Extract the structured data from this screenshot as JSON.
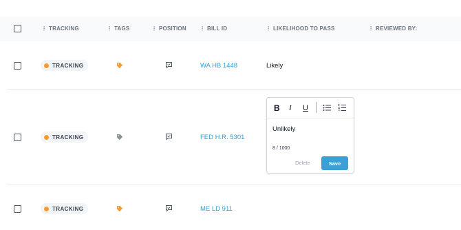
{
  "columns": {
    "tracking": "TRACKING",
    "tags": "TAGS",
    "position": "POSITION",
    "bill_id": "BILL ID",
    "likelihood": "LIKELIHOOD TO PASS",
    "reviewed_by": "REVIEWED BY:"
  },
  "rows": [
    {
      "tracking": "TRACKING",
      "tag_color": "#f39c34",
      "bill_id": "WA HB 1448",
      "likelihood": "Likely"
    },
    {
      "tracking": "TRACKING",
      "tag_color": "#8b8f96",
      "bill_id": "FED H.R. 5301",
      "likelihood": ""
    },
    {
      "tracking": "TRACKING",
      "tag_color": "#f39c34",
      "bill_id": "ME LD 911",
      "likelihood": ""
    }
  ],
  "editor": {
    "toolbar": {
      "bold_label": "B",
      "italic_label": "I",
      "underline_label": "U"
    },
    "text": "Unlikely",
    "counter": "8 / 1000",
    "delete_label": "Delete",
    "save_label": "Save"
  },
  "colors": {
    "accent": "#3aa0d6",
    "link": "#2b9fd4",
    "tracking_dot": "#f39c34"
  }
}
